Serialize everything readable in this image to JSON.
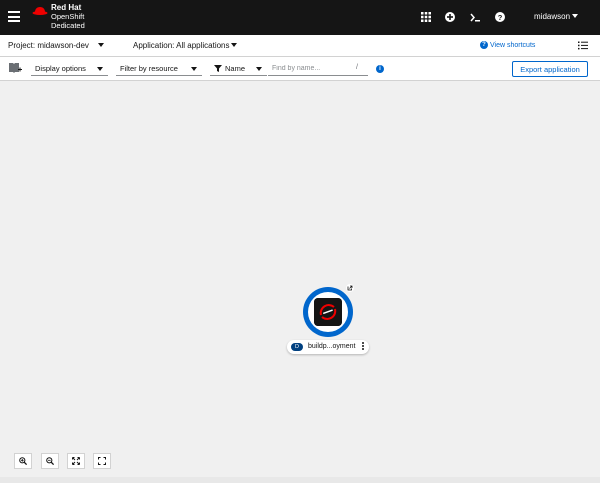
{
  "masthead": {
    "brand_line1": "Red Hat",
    "brand_line2": "OpenShift",
    "brand_line3": "Dedicated",
    "user": "midawson",
    "icons": [
      "hamburger-icon",
      "app-launcher-icon",
      "plus-icon",
      "terminal-icon",
      "help-icon"
    ],
    "background": "#151515"
  },
  "projectbar": {
    "project": "Project: midawson-dev",
    "application": "Application: All applications",
    "view_shortcuts": "View shortcuts"
  },
  "toolbar": {
    "display_options": "Display options",
    "filter_by_resource": "Filter by resource",
    "name_filter": "Name",
    "find_placeholder": "Find by name...",
    "find_hint": "/",
    "export_label": "Export application"
  },
  "topology": {
    "node_badge": "D",
    "node_name": "buildp...oyment",
    "node_ring_color": "#0066cc",
    "badge_color": "#004080"
  },
  "zoom_controls": [
    "zoom-in-icon",
    "zoom-out-icon",
    "fit-to-screen-icon",
    "reset-view-icon"
  ],
  "colors": {
    "accent": "#0066cc",
    "brand_red": "#ee0000"
  }
}
